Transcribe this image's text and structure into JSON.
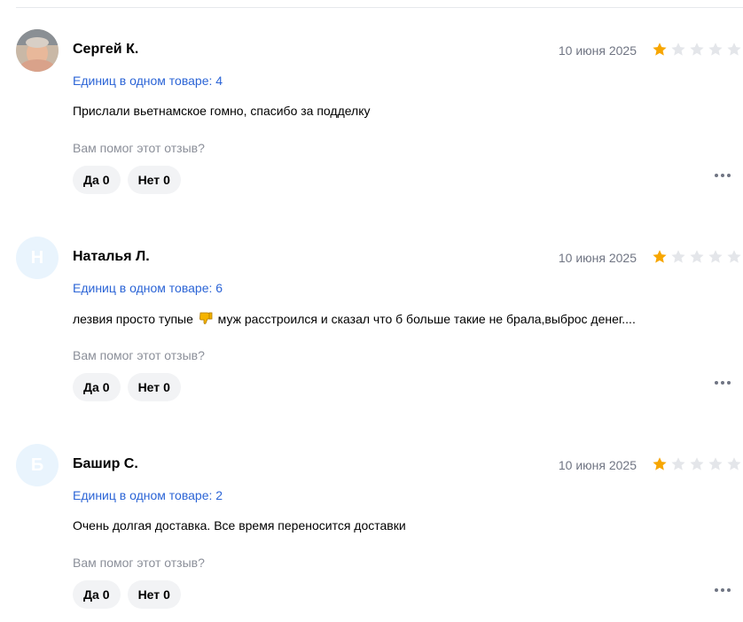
{
  "helpful_question": "Вам помог этот отзыв?",
  "yes_label": "Да",
  "no_label": "Нет",
  "icons": {
    "star": "star-icon",
    "more": "more-dots-icon",
    "thumbs_down": "thumbs-down-emoji"
  },
  "colors": {
    "star_filled": "#f7a600",
    "star_empty": "#e4e6ea",
    "link": "#2b64d6",
    "avatar_bg": "#e9f4fd"
  },
  "reviews": [
    {
      "author": "Сергей К.",
      "avatar_letter": "",
      "date": "10 июня 2025",
      "rating": 1,
      "units": "Единиц в одном товаре: 4",
      "text": "Прислали вьетнамское гомно, спасибо за подделку",
      "text_after": "",
      "yes_count": "0",
      "no_count": "0"
    },
    {
      "author": "Наталья Л.",
      "avatar_letter": "Н",
      "date": "10 июня 2025",
      "rating": 1,
      "units": "Единиц в одном товаре: 6",
      "text": "лезвия просто тупые",
      "text_after": "муж расстроился и сказал что б больше такие не брала,выброс денег....",
      "yes_count": "0",
      "no_count": "0"
    },
    {
      "author": "Башир С.",
      "avatar_letter": "Б",
      "date": "10 июня 2025",
      "rating": 1,
      "units": "Единиц в одном товаре: 2",
      "text": "Очень долгая доставка. Все время переносится доставки",
      "text_after": "",
      "yes_count": "0",
      "no_count": "0"
    }
  ]
}
